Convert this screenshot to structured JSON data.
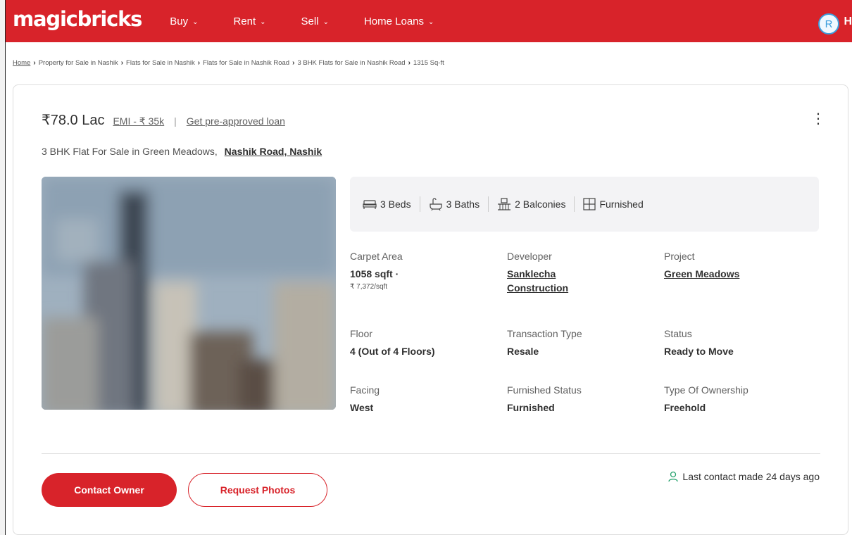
{
  "header": {
    "logo": "magicbricks",
    "nav": [
      {
        "label": "Buy"
      },
      {
        "label": "Rent"
      },
      {
        "label": "Sell"
      },
      {
        "label": "Home Loans"
      }
    ],
    "avatar_initial": "R",
    "avatar_trail": "H",
    "brand_color": "#d8232a"
  },
  "breadcrumb": [
    "Home",
    "Property for Sale in Nashik",
    "Flats for Sale in Nashik",
    "Flats for Sale in Nashik Road",
    "3 BHK Flats for Sale in Nashik Road",
    "1315 Sq-ft"
  ],
  "listing": {
    "price": "₹78.0 Lac",
    "emi": "EMI - ₹ 35k",
    "pipe": "|",
    "preapproved": "Get pre-approved loan",
    "title_prefix": "3 BHK Flat For Sale in Green Meadows,",
    "title_location": "Nashik Road, Nashik",
    "amenities": [
      {
        "icon": "bed-icon",
        "label": "3 Beds"
      },
      {
        "icon": "bath-icon",
        "label": "3 Baths"
      },
      {
        "icon": "balcony-icon",
        "label": "2 Balconies"
      },
      {
        "icon": "furnished-icon",
        "label": "Furnished"
      }
    ],
    "details": {
      "carpet_area": {
        "label": "Carpet Area",
        "value": "1058 sqft ·",
        "sub": "₹ 7,372/sqft"
      },
      "developer": {
        "label": "Developer",
        "value": "Sanklecha Construction"
      },
      "project": {
        "label": "Project",
        "value": "Green Meadows"
      },
      "floor": {
        "label": "Floor",
        "value": "4 (Out of 4 Floors)"
      },
      "transaction": {
        "label": "Transaction Type",
        "value": "Resale"
      },
      "status": {
        "label": "Status",
        "value": "Ready to Move"
      },
      "facing": {
        "label": "Facing",
        "value": "West"
      },
      "furnished_status": {
        "label": "Furnished Status",
        "value": "Furnished"
      },
      "ownership": {
        "label": "Type Of Ownership",
        "value": "Freehold"
      }
    },
    "actions": {
      "contact_owner": "Contact Owner",
      "request_photos": "Request Photos"
    },
    "last_contact": "Last contact made 24 days ago"
  }
}
